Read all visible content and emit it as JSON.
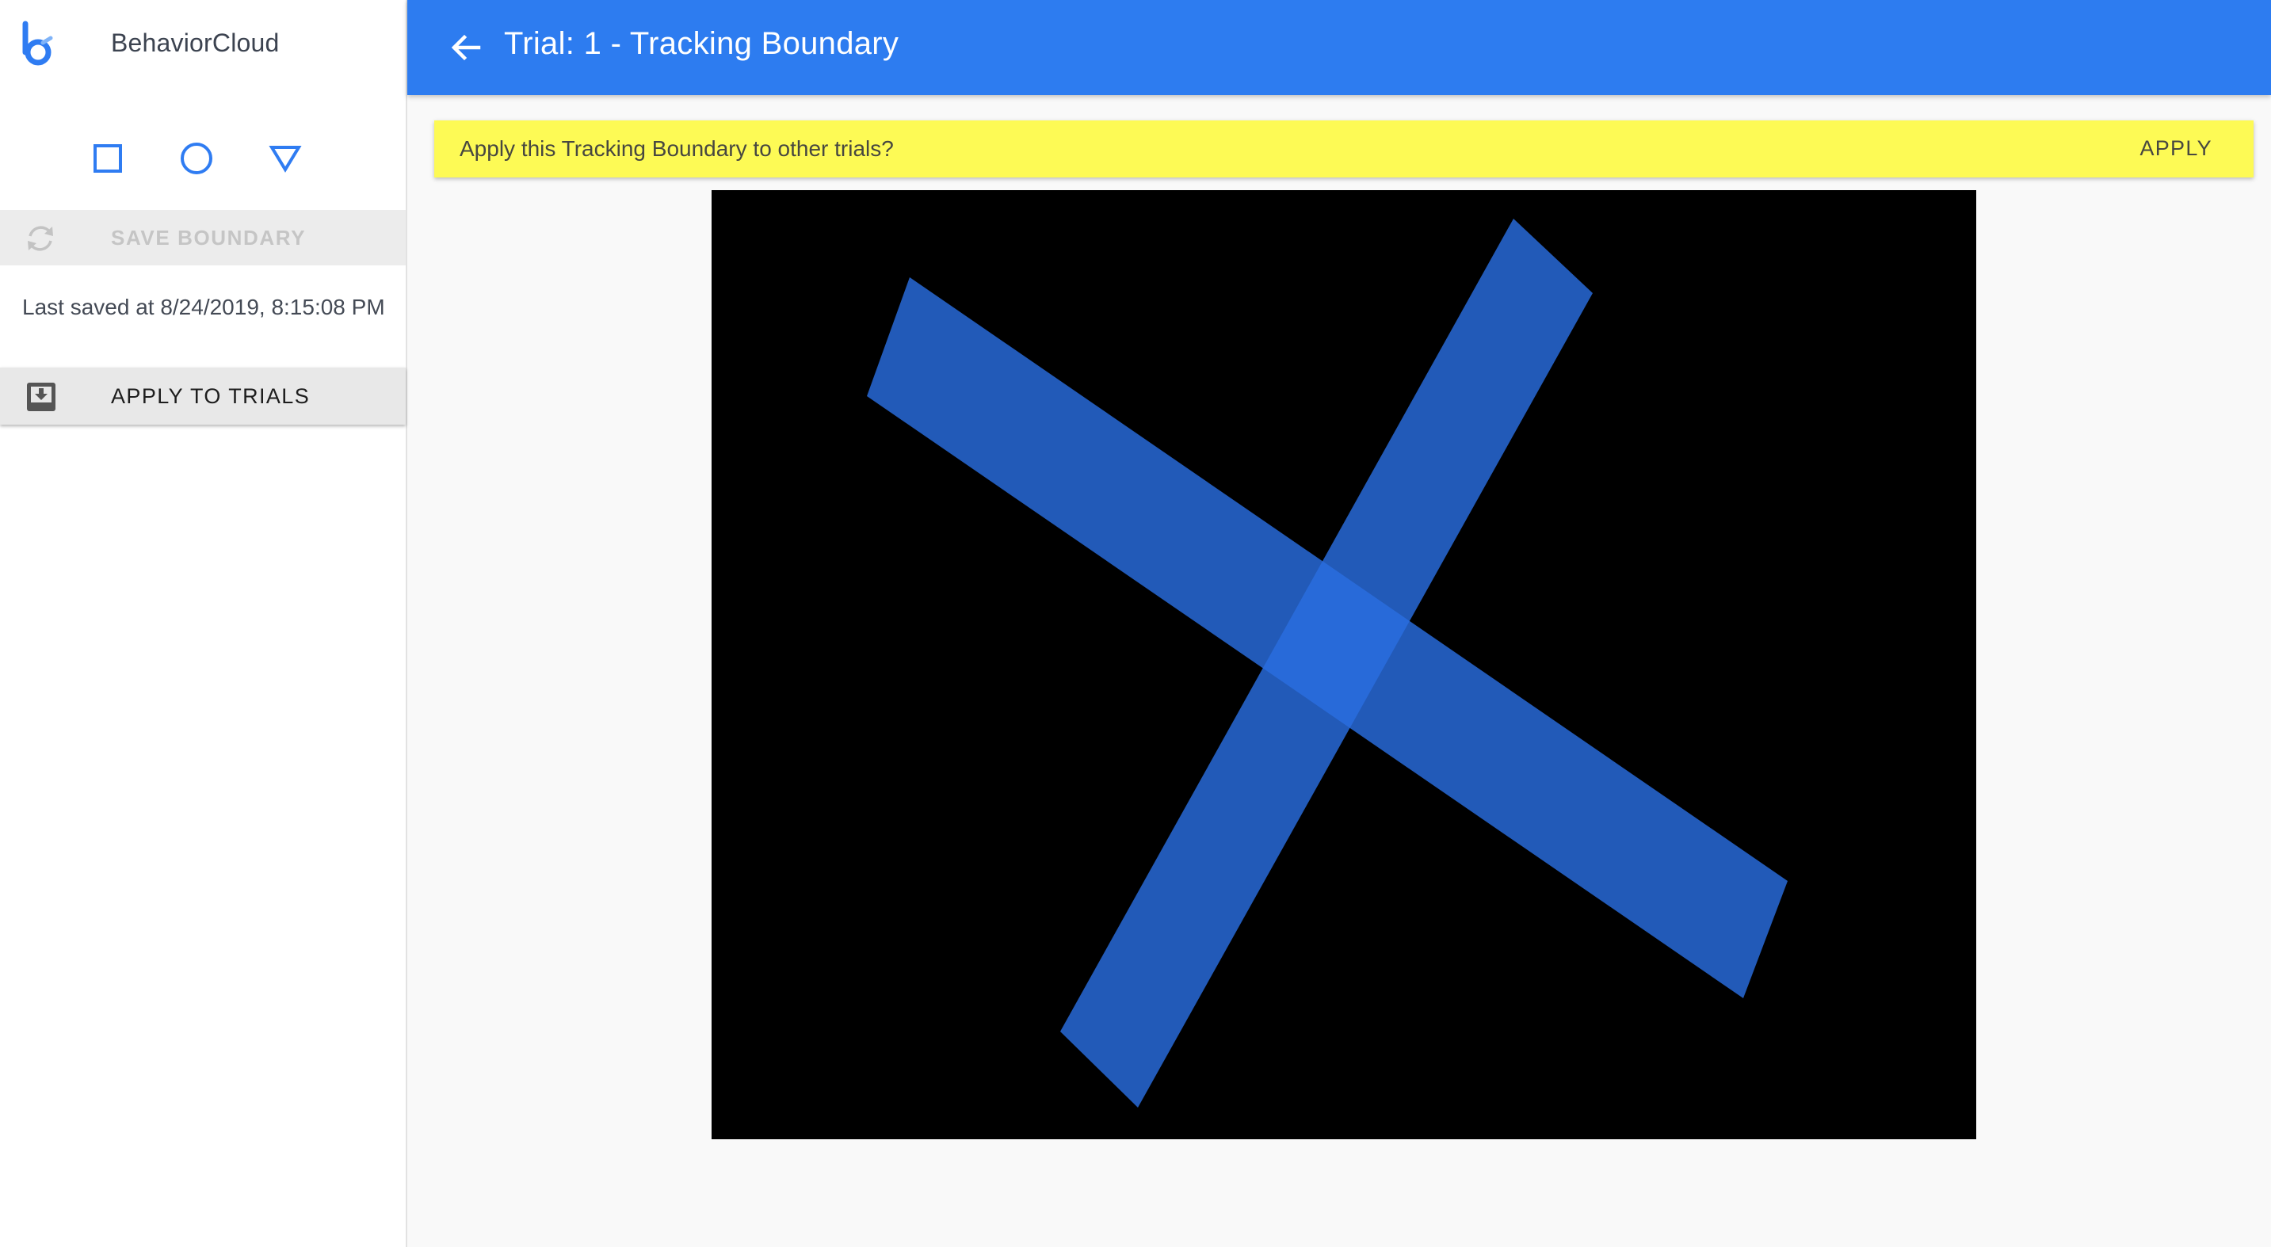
{
  "app": {
    "name": "BehaviorCloud"
  },
  "sidebar": {
    "shape_tools": [
      {
        "name": "square-tool",
        "icon": "square-icon"
      },
      {
        "name": "circle-tool",
        "icon": "circle-icon"
      },
      {
        "name": "triangle-tool",
        "icon": "triangle-icon"
      }
    ],
    "save_boundary_label": "SAVE BOUNDARY",
    "save_boundary_icon": "sync-icon",
    "last_saved": "Last saved at 8/24/2019, 8:15:08 PM",
    "apply_to_trials_label": "APPLY TO TRIALS",
    "apply_to_trials_icon": "inbox-download-icon"
  },
  "header": {
    "title": "Trial: 1 - Tracking Boundary",
    "back_icon": "arrow-left-icon"
  },
  "notice": {
    "text": "Apply this Tracking Boundary to other trials?",
    "action_label": "APPLY"
  },
  "colors": {
    "accent": "#2d7cf0",
    "tool_icon": "#2f7cf2",
    "notice_bg": "#fdfa55",
    "boundary_fill": "#2a6ee0",
    "canvas_bg": "#000000"
  }
}
